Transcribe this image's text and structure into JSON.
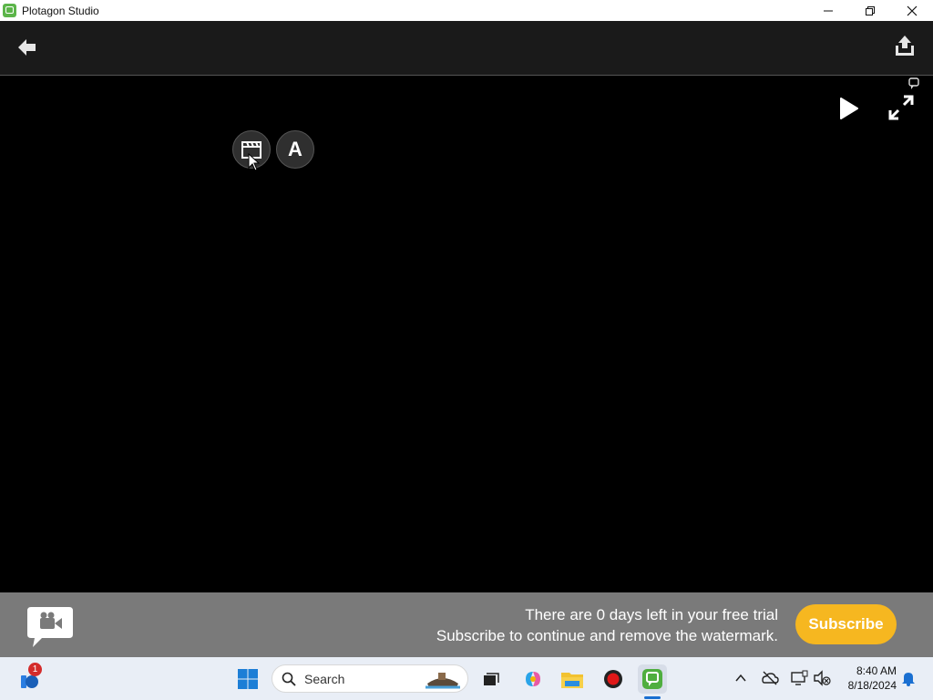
{
  "window": {
    "title": "Plotagon Studio"
  },
  "stage": {
    "text_tool_label": "A"
  },
  "banner": {
    "line1": "There are 0 days left in your free trial",
    "line2": "Subscribe to continue and remove the watermark.",
    "subscribe_label": "Subscribe",
    "accent": "#f6b720",
    "background": "#7a7a7a"
  },
  "taskbar": {
    "search_placeholder": "Search",
    "notification_count": "1",
    "time": "8:40 AM",
    "date": "8/18/2024"
  },
  "icons": {
    "back": "arrow-left-icon",
    "share": "share-icon",
    "play": "play-icon",
    "fullscreen": "expand-icon",
    "scene": "clapperboard-icon"
  }
}
